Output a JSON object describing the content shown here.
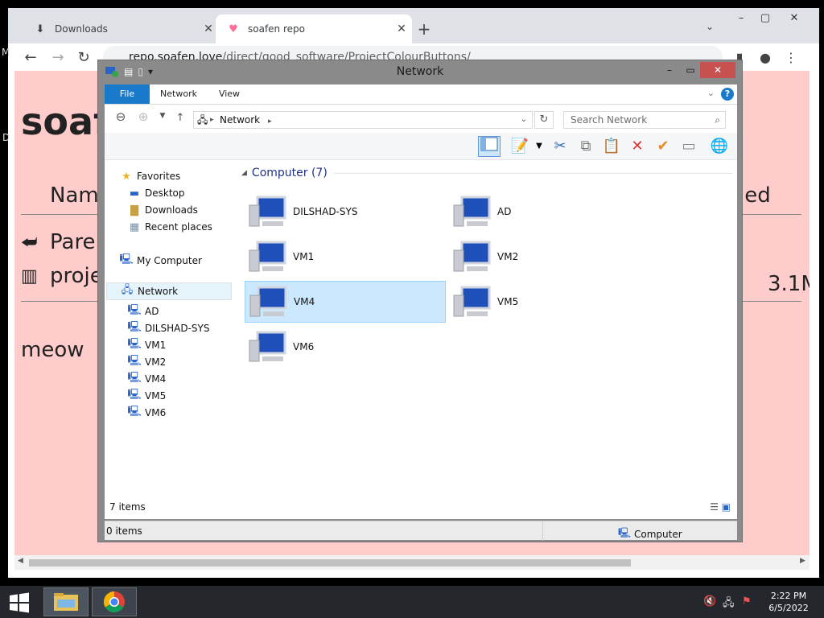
{
  "browser": {
    "tabs": [
      {
        "label": "Downloads",
        "icon": "download-icon",
        "active": false
      },
      {
        "label": "soafen repo",
        "icon": "heart-icon",
        "active": true
      }
    ],
    "url_host": "repo.soafen.love",
    "url_path": "/direct/good_software/ProjectColourButtons/",
    "side_text_m": "M",
    "side_text_d": "D"
  },
  "page": {
    "title": "soaf",
    "col_name": "Name",
    "col_modified": "ied",
    "rows": [
      {
        "icon": "back-arrow-icon",
        "label": "Pare"
      },
      {
        "icon": "archive-icon",
        "label": "proje"
      }
    ],
    "size": "3.1M",
    "footer": "meow"
  },
  "explorer": {
    "title": "Network",
    "ribbon_tabs": [
      "File",
      "Network",
      "View"
    ],
    "address": "Network",
    "search_placeholder": "Search Network",
    "nav": {
      "favorites": "Favorites",
      "favorites_items": [
        "Desktop",
        "Downloads",
        "Recent places"
      ],
      "my_computer": "My Computer",
      "network": "Network",
      "network_items": [
        "AD",
        "DILSHAD-SYS",
        "VM1",
        "VM2",
        "VM4",
        "VM5",
        "VM6"
      ]
    },
    "group_header": "Computer (7)",
    "computers": [
      {
        "name": "DILSHAD-SYS",
        "selected": false
      },
      {
        "name": "AD",
        "selected": false
      },
      {
        "name": "VM1",
        "selected": false
      },
      {
        "name": "VM2",
        "selected": false
      },
      {
        "name": "VM4",
        "selected": true
      },
      {
        "name": "VM5",
        "selected": false
      },
      {
        "name": "VM6",
        "selected": false
      }
    ],
    "status_items": "7 items",
    "bottom_count": "0 items",
    "bottom_zone": "Computer"
  },
  "taskbar": {
    "time": "2:22 PM",
    "date": "6/5/2022"
  },
  "colors": {
    "page_bg": "#ffcccc",
    "ribbon_file": "#1979ca",
    "selection": "#cce8ff",
    "taskbar": "#24272c"
  }
}
